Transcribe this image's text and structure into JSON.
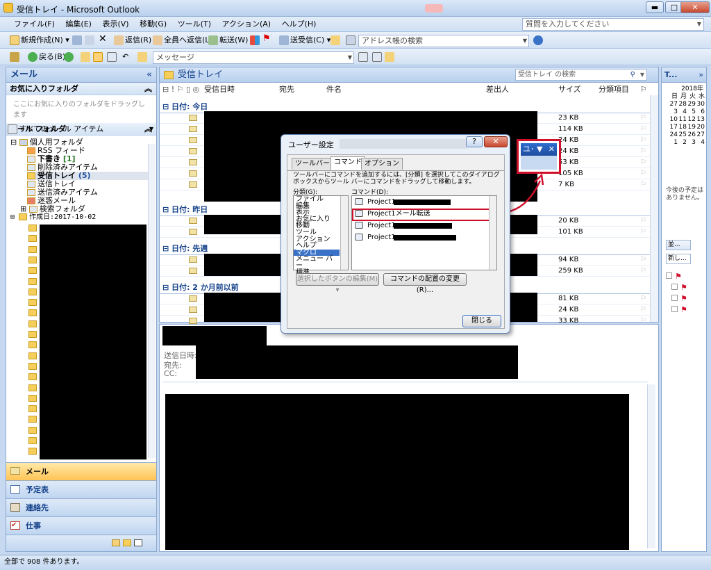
{
  "window": {
    "title": "受信トレイ - Microsoft Outlook",
    "min": "▬",
    "max": "□",
    "close": "✕"
  },
  "menu": [
    "ファイル(F)",
    "編集(E)",
    "表示(V)",
    "移動(G)",
    "ツール(T)",
    "アクション(A)",
    "ヘルプ(H)"
  ],
  "help_box": {
    "placeholder": "質問を入力してください"
  },
  "toolbar1": {
    "new": "新規作成(N)",
    "reply": "返信(R)",
    "reply_all": "全員へ返信(L)",
    "forward": "転送(W)",
    "send_receive": "送受信(C)",
    "address_search": "アドレス帳の検索"
  },
  "toolbar2": {
    "back": "戻る(B)",
    "message_combo": "メッセージ"
  },
  "nav": {
    "header": "メール",
    "favorites_title": "お気に入りフォルダ",
    "favorites_hint": "ここにお気に入りのフォルダをドラッグします",
    "mail_folders_title": "メール フォルダ",
    "all_items": "すべてのメール アイテム",
    "tree": {
      "personal": "個人用フォルダ",
      "rss": "RSS フィード",
      "drafts": "下書き",
      "drafts_count": "[1]",
      "deleted": "削除済みアイテム",
      "inbox": "受信トレイ",
      "inbox_count": "(5)",
      "outbox": "送信トレイ",
      "sent": "送信済みアイテム",
      "junk": "迷惑メール",
      "search": "検索フォルダ",
      "archive": "作成日:2017-10-02"
    },
    "buttons": {
      "mail": "メール",
      "calendar": "予定表",
      "contacts": "連絡先",
      "tasks": "仕事"
    }
  },
  "list": {
    "title": "受信トレイ",
    "search_placeholder": "受信トレイ の検索",
    "columns": {
      "received": "受信日時",
      "to": "宛先",
      "subject": "件名",
      "from": "差出人",
      "size": "サイズ",
      "category": "分類項目"
    },
    "groups": [
      "日付: 今日",
      "日付: 昨日",
      "日付: 先週",
      "日付: 2 か月前以前"
    ],
    "sizes_today": [
      "23 KB",
      "114 KB",
      "24 KB",
      "24 KB",
      "53 KB",
      "105 KB",
      "7 KB"
    ],
    "sizes_yesterday": [
      "20 KB",
      "101 KB"
    ],
    "sizes_lastweek": [
      "94 KB",
      "259 KB"
    ],
    "sizes_older": [
      "81 KB",
      "24 KB",
      "33 KB"
    ]
  },
  "reading": {
    "sent_label": "送信日時:",
    "to_label": "宛先:",
    "cc_label": "CC:"
  },
  "todo": {
    "title": "T...",
    "year": "2018年",
    "weekdays": [
      "日",
      "月",
      "火",
      "水"
    ],
    "weeks": [
      [
        "27",
        "28",
        "29",
        "30"
      ],
      [
        "3",
        "4",
        "5",
        "6"
      ],
      [
        "10",
        "11",
        "12",
        "13"
      ],
      [
        "17",
        "18",
        "19",
        "20"
      ],
      [
        "24",
        "25",
        "26",
        "27"
      ],
      [
        "1",
        "2",
        "3",
        "4"
      ]
    ],
    "no_appointments": "今後の予定はありません。",
    "sort_label": "並...",
    "new_task": "新し..."
  },
  "status": "全部で 908 件あります。",
  "dialog": {
    "title": "ユーザー設定",
    "help": "?",
    "close": "✕",
    "tabs": [
      "ツールバー",
      "コマンド",
      "オプション"
    ],
    "instructions": "ツールバーにコマンドを追加するには、[分類] を選択してこのダイアログ ボックスからツール バーにコマンドをドラッグして移動します。",
    "categories_label": "分類(G):",
    "commands_label": "コマンド(D):",
    "categories": [
      "ファイル",
      "編集",
      "表示",
      "お気に入り",
      "移動",
      "ツール",
      "アクション",
      "ヘルプ",
      "マクロ",
      "メニュー バー",
      "標準"
    ],
    "selected_category": "マクロ",
    "commands": [
      "Project1",
      "Project1メール転送",
      "Project1",
      "Project1"
    ],
    "edit_button": "選択したボタンの編集(M) ▾",
    "rearrange_button": "コマンドの配置の変更(R)...",
    "close_button": "閉じる"
  },
  "floating_toolbar": {
    "label": "ユ･"
  }
}
